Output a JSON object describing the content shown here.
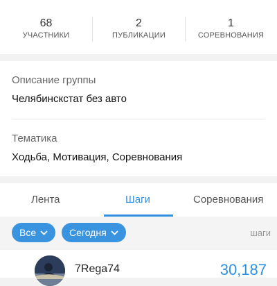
{
  "stats": [
    {
      "value": "68",
      "label": "УЧАСТНИКИ"
    },
    {
      "value": "2",
      "label": "ПУБЛИКАЦИИ"
    },
    {
      "value": "1",
      "label": "СОРЕВНОВАНИЯ"
    }
  ],
  "group": {
    "description_label": "Описание группы",
    "description": "Челябинскстат без авто",
    "topic_label": "Тематика",
    "topic": "Ходьба, Мотивация, Соревнования"
  },
  "tabs": [
    {
      "label": "Лента",
      "active": false
    },
    {
      "label": "Шаги",
      "active": true
    },
    {
      "label": "Соревнования",
      "active": false
    }
  ],
  "filters": {
    "scope": "Все",
    "period": "Сегодня",
    "unit_label": "шаги"
  },
  "leaderboard": [
    {
      "name": "7Rega74",
      "steps": "30,187"
    }
  ],
  "colors": {
    "accent": "#2f8fe0",
    "chip_bg": "#3a93de",
    "background": "#f2f2f2"
  }
}
